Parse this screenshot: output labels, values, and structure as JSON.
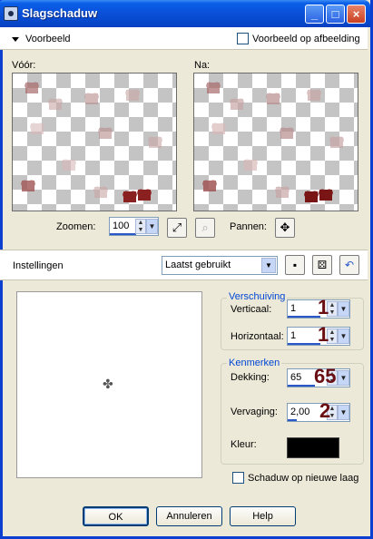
{
  "window": {
    "title": "Slagschaduw"
  },
  "titlebar_buttons": [
    "_",
    "□",
    "×"
  ],
  "preview_header": {
    "label": "Voorbeeld",
    "image_preview_label": "Voorbeeld op afbeelding",
    "image_preview_checked": false
  },
  "previews": {
    "before_label": "Vóór:",
    "after_label": "Na:"
  },
  "zoom": {
    "label": "Zoomen:",
    "value": "100",
    "pan_label": "Pannen:"
  },
  "settings": {
    "label": "Instellingen",
    "preset": "Laatst gebruikt"
  },
  "offset": {
    "title": "Verschuiving",
    "vertical_label": "Verticaal:",
    "vertical_value": "1",
    "horizontal_label": "Horizontaal:",
    "horizontal_value": "1"
  },
  "properties": {
    "title": "Kenmerken",
    "opacity_label": "Dekking:",
    "opacity_value": "65",
    "blur_label": "Vervaging:",
    "blur_value": "2,00",
    "color_label": "Kleur:",
    "color": "#000000"
  },
  "annotations": {
    "vertical": "1",
    "horizontal": "1",
    "opacity": "65",
    "blur": "2"
  },
  "new_layer": {
    "label": "Schaduw op nieuwe laag",
    "checked": false
  },
  "buttons": {
    "ok": "OK",
    "cancel": "Annuleren",
    "help": "Help"
  },
  "colors": {
    "titlebar": "#0a4fd8",
    "dialog_bg": "#ece9d8",
    "group_title": "#0046d5",
    "annotation": "#6a0e14"
  }
}
